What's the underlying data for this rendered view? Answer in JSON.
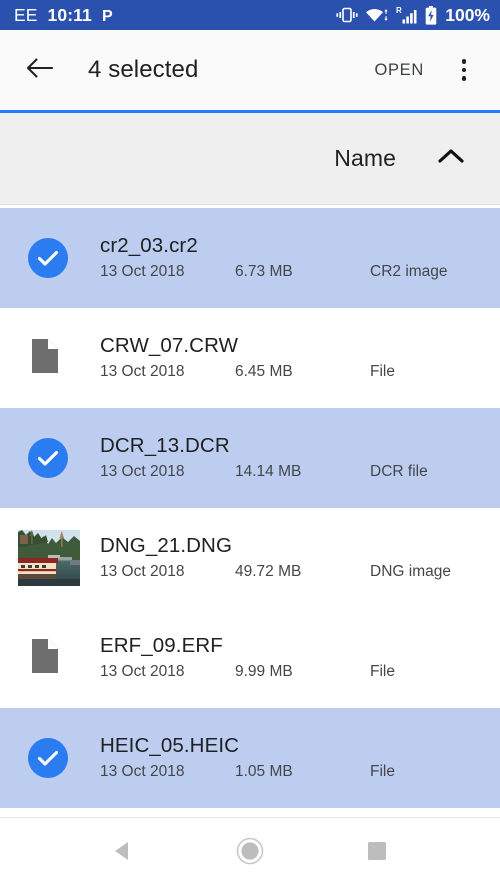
{
  "status_bar": {
    "carrier": "EE",
    "clock": "10:11",
    "parking_icon": "parking-p-icon",
    "vibrate_icon": "vibrate-icon",
    "wifi_icon": "wifi-icon",
    "roaming_label": "R",
    "signal_icon": "cellular-signal-icon",
    "battery_icon": "battery-charging-icon",
    "battery_percent": "100%",
    "background_color": "#2a51ae",
    "text_color": "#ffffff"
  },
  "app_bar": {
    "back_icon": "back-arrow-icon",
    "title": "4 selected",
    "open_label": "OPEN",
    "overflow_icon": "more-vertical-icon",
    "background_color": "#fafafa",
    "accent_color": "#2979ff"
  },
  "sort_bar": {
    "label": "Name",
    "direction_icon": "chevron-up-icon",
    "direction": "ascending",
    "background_color": "#efefef"
  },
  "list": {
    "selected_row_color": "#bdcdf0",
    "checkbox_color": "#2a7cf0",
    "files": [
      {
        "name": "cr2_03.cr2",
        "date": "13 Oct 2018",
        "size": "6.73 MB",
        "type": "CR2 image",
        "selected": true,
        "icon": "check-circle-icon"
      },
      {
        "name": "CRW_07.CRW",
        "date": "13 Oct 2018",
        "size": "6.45 MB",
        "type": "File",
        "selected": false,
        "icon": "document-icon"
      },
      {
        "name": "DCR_13.DCR",
        "date": "13 Oct 2018",
        "size": "14.14 MB",
        "type": "DCR file",
        "selected": true,
        "icon": "check-circle-icon"
      },
      {
        "name": "DNG_21.DNG",
        "date": "13 Oct 2018",
        "size": "49.72 MB",
        "type": "DNG image",
        "selected": false,
        "icon": "photo-thumbnail"
      },
      {
        "name": "ERF_09.ERF",
        "date": "13 Oct 2018",
        "size": "9.99 MB",
        "type": "File",
        "selected": false,
        "icon": "document-icon"
      },
      {
        "name": "HEIC_05.HEIC",
        "date": "13 Oct 2018",
        "size": "1.05 MB",
        "type": "File",
        "selected": true,
        "icon": "check-circle-icon"
      }
    ]
  },
  "nav_bar": {
    "back_icon": "nav-back-triangle-icon",
    "home_icon": "nav-home-circle-icon",
    "recents_icon": "nav-recents-square-icon",
    "icon_color": "#bdbdbd"
  }
}
